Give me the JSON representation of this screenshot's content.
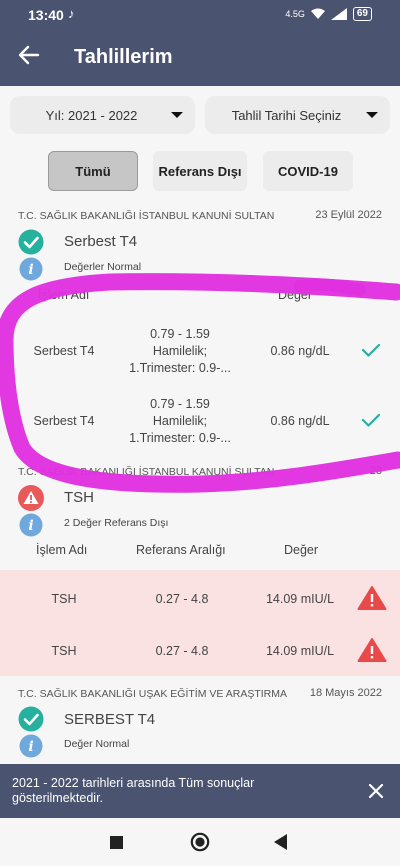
{
  "status_bar": {
    "time": "13:40",
    "signal": "4.5G",
    "battery": "69"
  },
  "header": {
    "title": "Tahlillerim"
  },
  "filters": {
    "year": "Yıl: 2021 - 2022",
    "date": "Tahlil Tarihi Seçiniz"
  },
  "tabs": [
    {
      "label": "Tümü"
    },
    {
      "label": "Referans Dışı"
    },
    {
      "label": "COVID-19"
    }
  ],
  "results": [
    {
      "institution": "T.C. SAĞLIK BAKANLIĞI İSTANBUL KANUNİ SULTAN",
      "date": "23 Eylül 2022",
      "test": "Serbest T4",
      "status": "Değerler Normal",
      "columns": {
        "name": "İşlem Adı",
        "value": "Değer"
      },
      "rows": [
        {
          "name": "Serbest T4",
          "range_l1": "0.79 - 1.59",
          "range_l2": "Hamilelik;",
          "range_l3": "1.Trimester: 0.9-...",
          "value": "0.86 ng/dL"
        },
        {
          "name": "Serbest T4",
          "range_l1": "0.79 - 1.59",
          "range_l2": "Hamilelik;",
          "range_l3": "1.Trimester: 0.9-...",
          "value": "0.86 ng/dL"
        }
      ]
    },
    {
      "institution": "T.C. SAĞLIK BAKANLIĞI İSTANBUL KANUNİ SULTAN",
      "date": "23",
      "test": "TSH",
      "status": "2 Değer Referans Dışı",
      "columns": {
        "name": "İşlem Adı",
        "range": "Referans Aralığı",
        "value": "Değer"
      },
      "rows": [
        {
          "name": "TSH",
          "range": "0.27 - 4.8",
          "value": "14.09 mIU/L"
        },
        {
          "name": "TSH",
          "range": "0.27 - 4.8",
          "value": "14.09 mIU/L"
        }
      ]
    },
    {
      "institution": "T.C. SAĞLIK BAKANLIĞI UŞAK EĞİTİM VE ARAŞTIRMA",
      "date": "18 Mayıs 2022",
      "test": "SERBEST T4",
      "status": "Değer Normal"
    }
  ],
  "toast": {
    "message": "2021 - 2022 tarihleri arasında Tüm sonuçlar gösterilmektedir."
  },
  "colors": {
    "primary": "#4a5470",
    "ok": "#26b09e",
    "info": "#6fa8dc",
    "warn": "#e85a5a",
    "band": "#fbe2e2",
    "annotation": "#e030e0"
  }
}
